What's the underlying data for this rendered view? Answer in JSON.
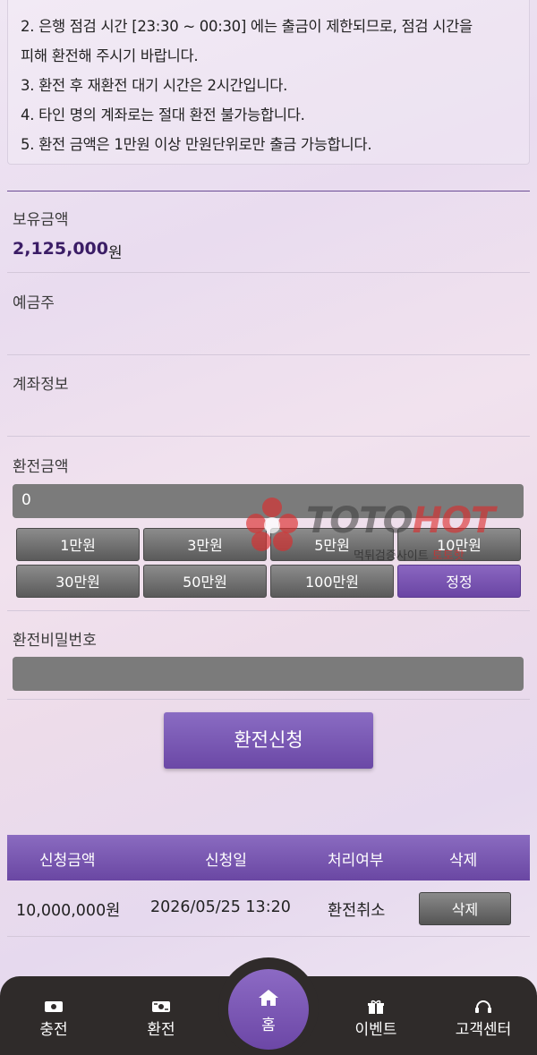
{
  "notice": {
    "lines": [
      "2. 은행 점검 시간 [23:30 ~ 00:30] 에는 출금이 제한되므로, 점검 시간을",
      "피해 환전해 주시기 바랍니다.",
      "3. 환전 후 재환전 대기 시간은 2시간입니다.",
      "4. 타인 명의 계좌로는 절대 환전 불가능합니다.",
      "5. 환전 금액은 1만원 이상 만원단위로만 출금 가능합니다."
    ]
  },
  "form": {
    "balance_label": "보유금액",
    "balance_value": "2,125,000",
    "balance_unit": "원",
    "holder_label": "예금주",
    "account_label": "계좌정보",
    "amount_label": "환전금액",
    "amount_value": "0",
    "quick_buttons": [
      "1만원",
      "3만원",
      "5만원",
      "10만원",
      "30만원",
      "50만원",
      "100만원",
      "정정"
    ],
    "password_label": "환전비밀번호",
    "submit_label": "환전신청"
  },
  "table": {
    "headers": [
      "신청금액",
      "신청일",
      "처리여부",
      "삭제"
    ],
    "rows": [
      {
        "amount": "10,000,000원",
        "date": "2026/05/25 13:20",
        "status": "환전취소",
        "delete_label": "삭제"
      }
    ]
  },
  "watermark": {
    "brand_a": "TOTO",
    "brand_b": "HOT",
    "sub_a": "먹튀검증사이트",
    "sub_b": "토토핫"
  },
  "nav": {
    "items": [
      "충전",
      "환전",
      "홈",
      "이벤트",
      "고객센터"
    ]
  },
  "colors": {
    "accent": "#6f4aa8",
    "button_gray": "#6b6b6b",
    "nav_bg": "#2f2b2a",
    "balance_text": "#3b1d66"
  }
}
